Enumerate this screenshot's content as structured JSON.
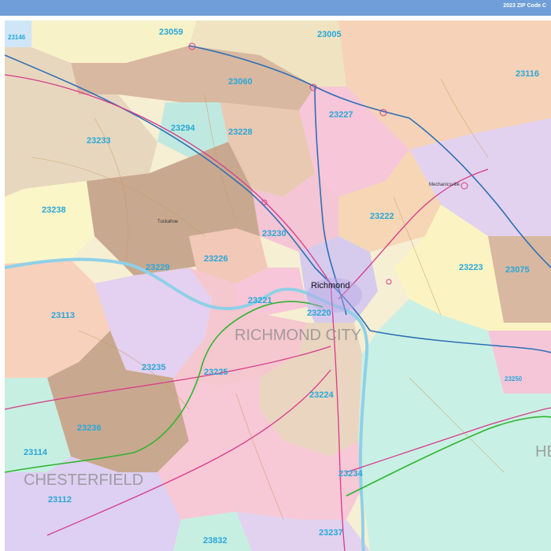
{
  "header": {
    "title": "2023 ZIP Code C"
  },
  "map": {
    "city_name": "Richmond",
    "county_labels": {
      "richmond_city": "RICHMOND CITY",
      "chesterfield": "CHESTERFIELD",
      "henrico_partial": "HE"
    },
    "places": {
      "tuckahoe": "Tuckahoe",
      "mechanicsville": "Mechanicsville"
    },
    "zip_codes": {
      "z23146": "23146",
      "z23059": "23059",
      "z23005": "23005",
      "z23116": "23116",
      "z23060": "23060",
      "z23227": "23227",
      "z23294": "23294",
      "z23228": "23228",
      "z23233": "23233",
      "z23238": "23238",
      "z23222": "23222",
      "z23230": "23230",
      "z23226": "23226",
      "z23229": "23229",
      "z23223": "23223",
      "z23075": "23075",
      "z23221": "23221",
      "z23220": "23220",
      "z23113": "23113",
      "z23235": "23235",
      "z23225": "23225",
      "z23224": "23224",
      "z23250": "23250",
      "z23236": "23236",
      "z23114": "23114",
      "z23112": "23112",
      "z23234": "23234",
      "z23832": "23832",
      "z23237": "23237"
    },
    "colors": {
      "header": "#6f9ed8",
      "zip_label": "#2aa7d8",
      "interstate": "#2d6fb5",
      "us_route": "#d63a8a",
      "parkway": "#2fb52f",
      "river": "#8fd0e8"
    }
  }
}
